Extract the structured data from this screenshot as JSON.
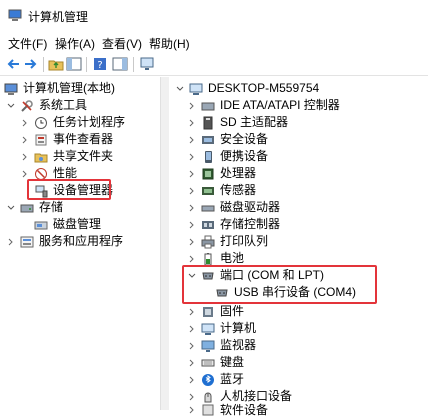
{
  "window": {
    "title": "计算机管理"
  },
  "menu": [
    "文件(F)",
    "操作(A)",
    "查看(V)",
    "帮助(H)"
  ],
  "left_tree": {
    "root": "计算机管理(本地)",
    "system_tools": "系统工具",
    "task_scheduler": "任务计划程序",
    "event_viewer": "事件查看器",
    "shared_folders": "共享文件夹",
    "performance": "性能",
    "device_manager": "设备管理器",
    "storage": "存储",
    "disk_management": "磁盘管理",
    "services_apps": "服务和应用程序"
  },
  "device_tree": {
    "computer": "DESKTOP-M559754",
    "categories": [
      "IDE ATA/ATAPI 控制器",
      "SD 主适配器",
      "安全设备",
      "便携设备",
      "处理器",
      "传感器",
      "磁盘驱动器",
      "存储控制器",
      "打印队列",
      "电池",
      "端口 (COM 和 LPT)",
      "固件",
      "计算机",
      "监视器",
      "键盘",
      "蓝牙",
      "人机接口设备",
      "软件设备"
    ],
    "port_child": "USB 串行设备 (COM4)"
  }
}
